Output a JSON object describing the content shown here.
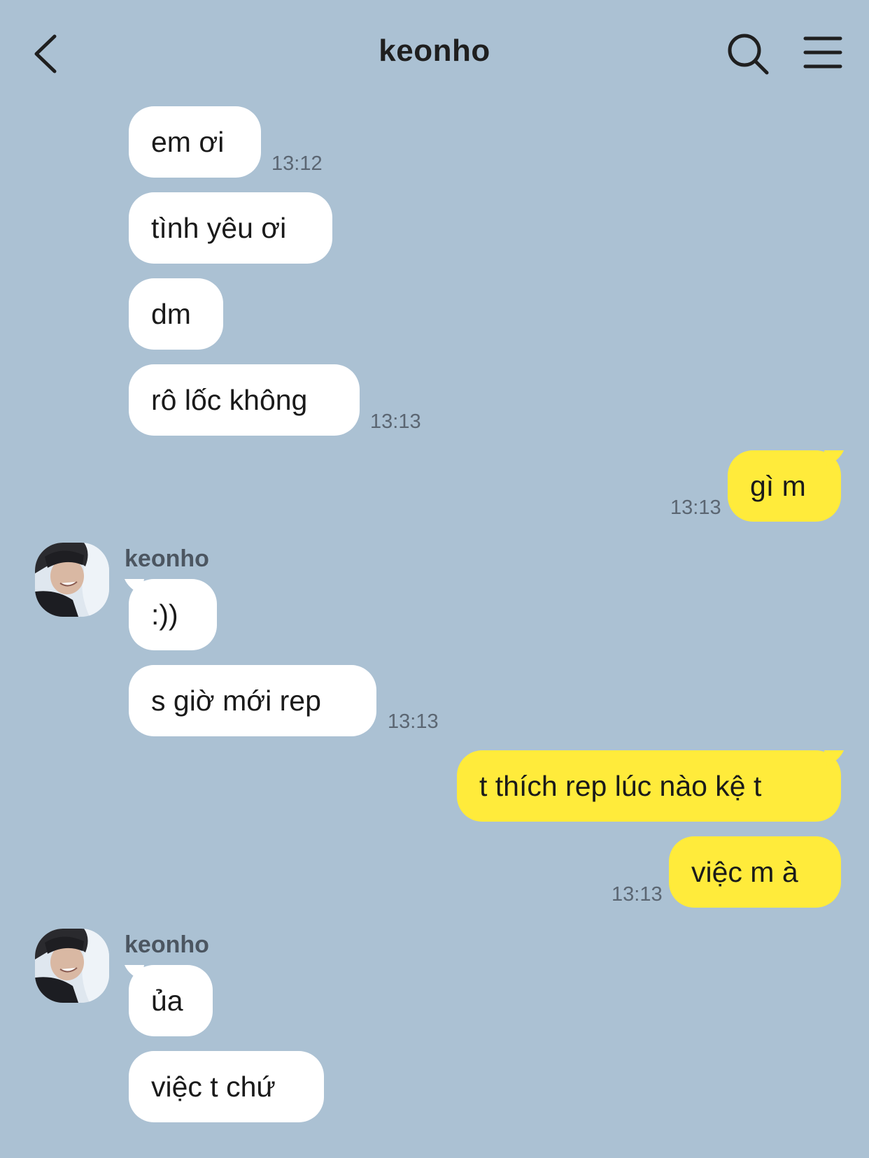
{
  "header": {
    "title": "keonho",
    "back_icon": "chevron-left-icon",
    "search_icon": "search-icon",
    "menu_icon": "hamburger-menu-icon"
  },
  "colors": {
    "background": "#abc1d3",
    "incoming_bubble": "#ffffff",
    "outgoing_bubble": "#ffeb3b"
  },
  "messages": [
    {
      "text": "em ơi",
      "time": "13:12"
    },
    {
      "text": "tình yêu ơi"
    },
    {
      "text": "dm"
    },
    {
      "text": "rô lốc không",
      "time": "13:13"
    },
    {
      "text": "gì m",
      "time": "13:13"
    },
    {
      "sender": "keonho",
      "text": ":))"
    },
    {
      "text": "s giờ mới rep",
      "time": "13:13"
    },
    {
      "text": "t thích rep lúc nào kệ t"
    },
    {
      "text": "việc m à",
      "time": "13:13"
    },
    {
      "sender": "keonho",
      "text": "ủa"
    },
    {
      "text": "việc t chứ"
    }
  ]
}
